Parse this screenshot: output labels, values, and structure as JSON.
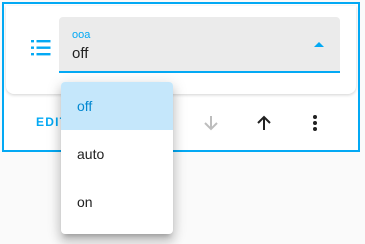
{
  "card": {
    "select": {
      "label": "ooa",
      "value": "off",
      "options": [
        "off",
        "auto",
        "on"
      ],
      "selected_index": 0
    },
    "actions": {
      "edit_label": "EDIT"
    },
    "icons": {
      "row": "list-icon",
      "down": "arrow-down-icon",
      "up": "arrow-up-icon",
      "more": "more-vertical-icon"
    }
  },
  "colors": {
    "accent": "#03a9f4",
    "selected_bg": "#c5e7fb",
    "field_bg": "#ebebeb",
    "disabled_icon": "#bdbdbd"
  }
}
